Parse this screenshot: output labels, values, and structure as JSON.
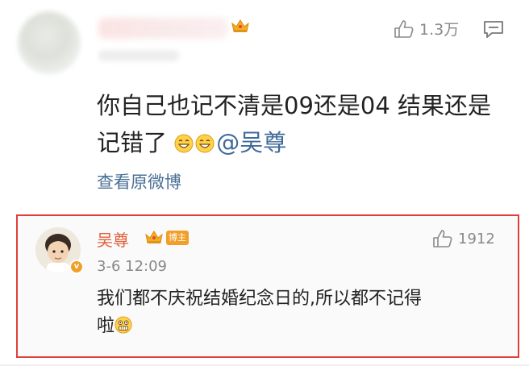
{
  "top_comment": {
    "like_count": "1.3万",
    "text_line1": "你自己也记不清是09还是04 结果还是",
    "text_line2": "记错了",
    "mention": "@吴尊",
    "view_original": "查看原微博"
  },
  "reply": {
    "username": "吴尊",
    "badge": "博主",
    "timestamp": "3-6 12:09",
    "like_count": "1912",
    "text_line1": "我们都不庆祝结婚纪念日的,所以都不记得",
    "text_line2": "啦"
  },
  "colors": {
    "highlight_border": "#e23d3d",
    "username": "#e0603a",
    "mention": "#3f6a98"
  }
}
